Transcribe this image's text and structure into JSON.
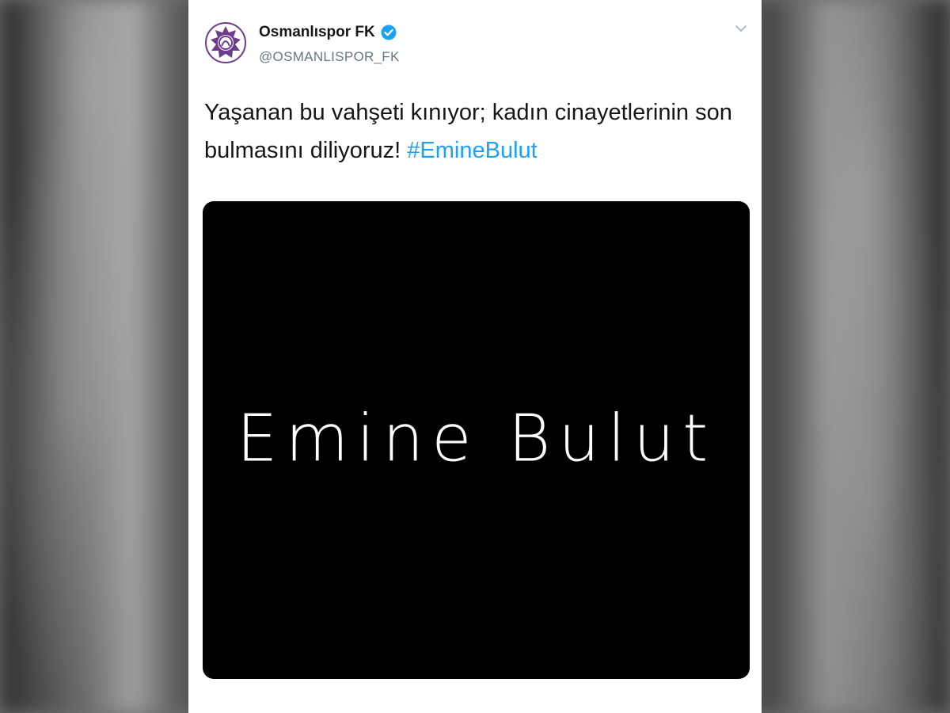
{
  "tweet": {
    "display_name": "Osmanlıspor FK",
    "handle": "@OSMANLISPOR_FK",
    "text": "Yaşanan bu vahşeti kınıyor; kadın cinayetlerinin son bulmasını diliyoruz!",
    "hashtag": "#EmineBulut",
    "media_text": "Emine Bulut",
    "verified": true,
    "icons": {
      "avatar": "club-logo-icon",
      "verified": "verified-badge-icon",
      "menu": "chevron-down-icon"
    }
  },
  "colors": {
    "accent": "#1da1f2",
    "text": "#14171a",
    "secondary_text": "#657786",
    "avatar_purple": "#6b3d8c",
    "media_background": "#000000"
  }
}
